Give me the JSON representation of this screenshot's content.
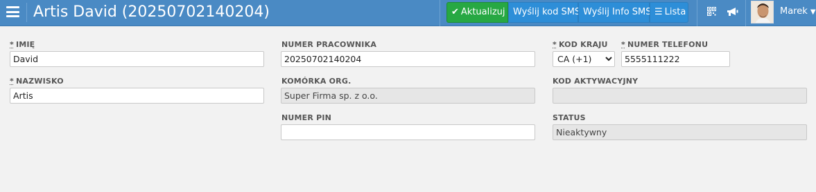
{
  "header": {
    "title": "Artis David (20250702140204)",
    "buttons": {
      "update": "Aktualizuj",
      "send_sms_code": "Wyślij kod SMS",
      "send_info_sms": "Wyślij Info SMS",
      "list": "Lista"
    },
    "user_name": "Marek"
  },
  "form": {
    "first_name": {
      "label": "IMIĘ",
      "value": "David",
      "required_marker": "*"
    },
    "last_name": {
      "label": "NAZWISKO",
      "value": "Artis",
      "required_marker": "*"
    },
    "employee_number": {
      "label": "NUMER PRACOWNIKA",
      "value": "20250702140204"
    },
    "org_unit": {
      "label": "KOMÓRKA ORG.",
      "value": "Super Firma sp. z o.o."
    },
    "pin": {
      "label": "NUMER PIN",
      "value": ""
    },
    "country_code": {
      "label": "KOD KRAJU",
      "value": "CA (+1)",
      "required_marker": "*"
    },
    "phone": {
      "label": "NUMER TELEFONU",
      "value": "5555111222",
      "required_marker": "*"
    },
    "activation_code": {
      "label": "KOD AKTYWACYJNY",
      "value": ""
    },
    "status": {
      "label": "STATUS",
      "value": "Nieaktywny"
    }
  }
}
